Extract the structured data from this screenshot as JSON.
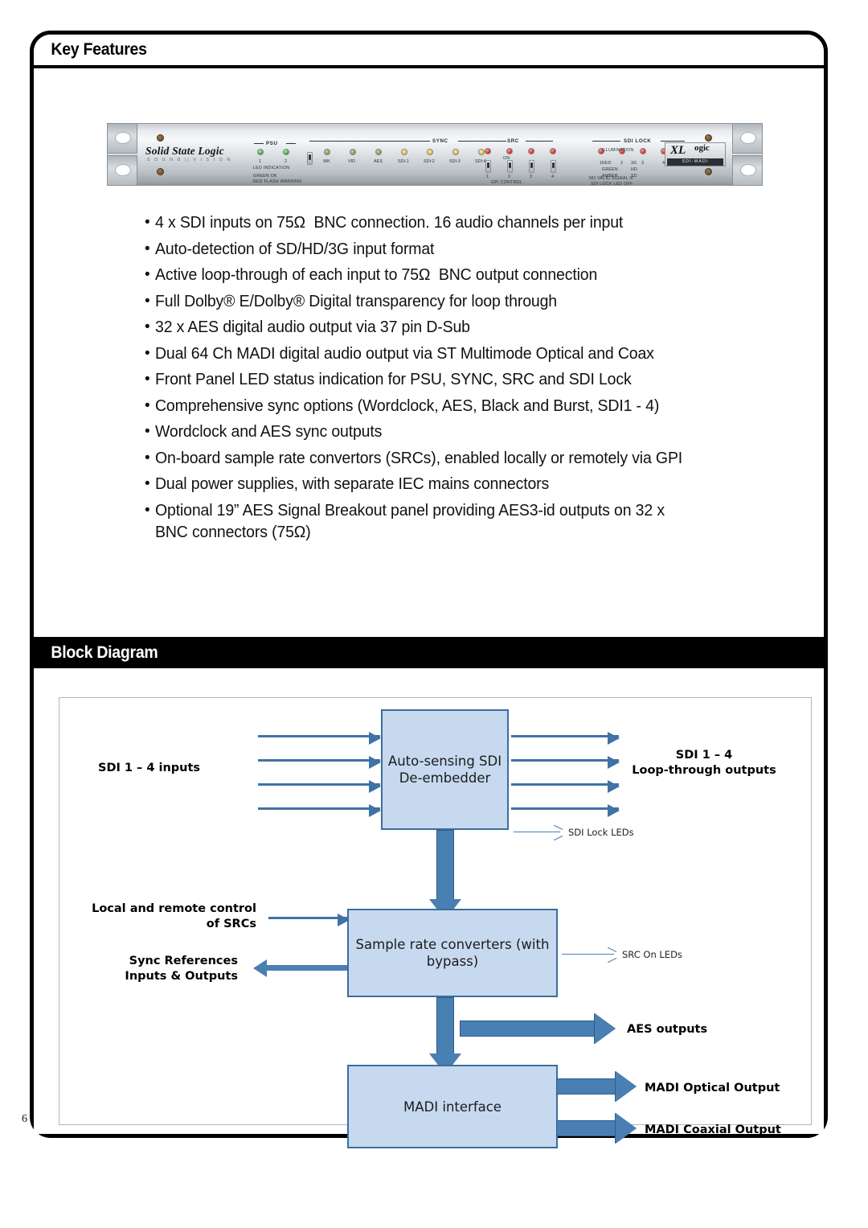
{
  "page": {
    "number": "6"
  },
  "sections": {
    "key_features": {
      "title": "Key Features",
      "items": [
        "4 x SDI inputs on 75Ω  BNC connection. 16 audio channels per input",
        "Auto-detection of SD/HD/3G input format",
        "Active loop-through of each input to 75Ω  BNC output connection",
        "Full Dolby® E/Dolby® Digital transparency for loop through",
        "32 x AES digital audio output via 37 pin D-Sub",
        "Dual 64 Ch MADI digital audio output via ST Multimode Optical and Coax",
        "Front Panel LED status indication for PSU, SYNC, SRC and SDI Lock",
        "Comprehensive sync options (Wordclock, AES, Black and Burst, SDI1 - 4)",
        "Wordclock and AES sync outputs",
        "On-board sample rate convertors (SRCs), enabled locally or remotely via GPI",
        "Dual power supplies, with separate IEC mains connectors",
        "Optional 19” AES Signal Breakout panel providing AES3-id outputs on 32 x\nBNC connectors (75Ω)"
      ]
    },
    "block_diagram": {
      "title": "Block Diagram"
    }
  },
  "rack_panel": {
    "brand": "Solid State Logic",
    "brand_sub": "S O U N D  ||  V I S I O N",
    "logo_main": "XL",
    "logo_sup": "ogic",
    "logo_bar": "SDI-MADI",
    "groups": {
      "psu": "PSU",
      "sync": "SYNC",
      "src": "SRC",
      "sdi_lock": "SDI LOCK"
    },
    "psu_ticks": [
      "1",
      "2"
    ],
    "psu_notes": [
      "LED INDICATION",
      "GREEN      OK",
      "RED FLASH  WARNING"
    ],
    "sync_ticks": [
      "WK",
      "VID",
      "AES",
      "SDI-1",
      "SDI-2",
      "SDI-3",
      "SDI-4"
    ],
    "src_ticks": [
      "1",
      "2",
      "3",
      "4"
    ],
    "src_on_label": "ON",
    "src_note": "GPI CONTROL",
    "sdi_lock_ticks": [
      "1",
      "2",
      "3",
      "4"
    ],
    "sdi_lock_notes": [
      "NO VALID SIGNAL IF",
      "SDI LOCK LED OFF"
    ],
    "illumination": {
      "title": "ILLUMINATION",
      "rows": [
        [
          "RED",
          "3G"
        ],
        [
          "GREEN",
          "HD"
        ],
        [
          "AMBER",
          "SD"
        ]
      ]
    }
  },
  "diagram": {
    "blocks": {
      "deembedder": "Auto-sensing\nSDI\nDe-embedder",
      "src": "Sample rate converters\n(with bypass)",
      "madi": "MADI interface"
    },
    "labels": {
      "sdi_inputs": "SDI 1 – 4 inputs",
      "loop_outputs": "SDI 1 – 4\nLoop-through outputs",
      "sdi_lock_leds": "SDI Lock LEDs",
      "src_control": "Local and remote control\nof SRCs",
      "sync_refs": "Sync References\nInputs & Outputs",
      "src_on_leds": "SRC On LEDs",
      "aes_outputs": "AES outputs",
      "madi_optical": "MADI Optical Output",
      "madi_coaxial": "MADI Coaxial Output"
    },
    "colors": {
      "block_fill": "#c6d9ef",
      "block_stroke": "#3c6e9d",
      "arrow_fill": "#4a7fb3",
      "arrow_stroke": "#2f5c88"
    }
  }
}
